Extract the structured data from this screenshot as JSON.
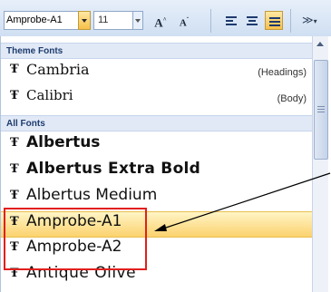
{
  "toolbar": {
    "font_name": "Amprobe-A1",
    "font_size": "11",
    "grow_font_label": "A",
    "shrink_font_label": "A"
  },
  "dropdown": {
    "theme_fonts_header": "Theme Fonts",
    "theme_fonts": [
      {
        "name": "Cambria",
        "tag": "(Headings)"
      },
      {
        "name": "Calibri",
        "tag": "(Body)"
      }
    ],
    "all_fonts_header": "All Fonts",
    "all_fonts": [
      {
        "name": "Albertus"
      },
      {
        "name": "Albertus Extra Bold"
      },
      {
        "name": "Albertus Medium"
      },
      {
        "name": "Amprobe-A1"
      },
      {
        "name": "Amprobe-A2"
      },
      {
        "name": "Antique Olive"
      }
    ]
  },
  "colors": {
    "highlight": "#fbd26e",
    "annotation_red": "#e0201c",
    "header_text": "#1e3c6e"
  }
}
